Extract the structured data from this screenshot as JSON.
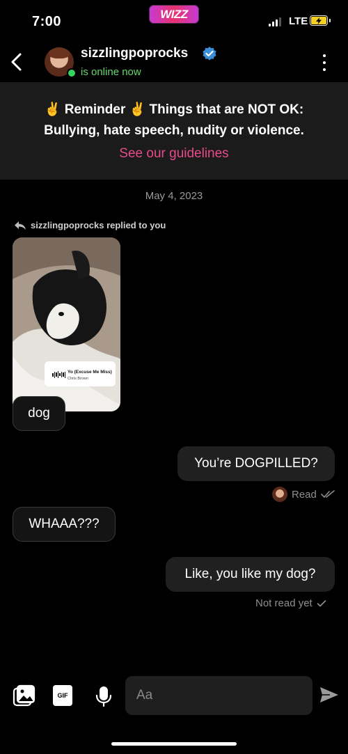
{
  "status_bar": {
    "time": "7:00",
    "network": "LTE",
    "app_badge": "WIZZ"
  },
  "header": {
    "username": "sizzlingpoprocks",
    "status": "is online now"
  },
  "banner": {
    "line1": "✌️ Reminder ✌️ Things that are NOT OK:",
    "line2": "Bullying, hate speech, nudity or violence.",
    "link": "See our guidelines"
  },
  "conversation": {
    "date": "May 4, 2023",
    "replied_label": "sizzlingpoprocks replied to you",
    "story_music": {
      "title": "Yo (Excuse Me Miss)",
      "artist": "Chris Brown"
    },
    "messages": [
      {
        "side": "in",
        "text": "dog"
      },
      {
        "side": "out",
        "text": "You’re DOGPILLED?",
        "receipt": "Read"
      },
      {
        "side": "in",
        "text": "WHAAA???"
      },
      {
        "side": "out",
        "text": "Like, you like my dog?",
        "receipt": "Not read yet"
      }
    ]
  },
  "composer": {
    "placeholder": "Aa",
    "gif_label": "GIF"
  },
  "colors": {
    "accent_pink": "#e84a8b",
    "online_green": "#37d35f",
    "verified_blue": "#3b8fd9"
  }
}
